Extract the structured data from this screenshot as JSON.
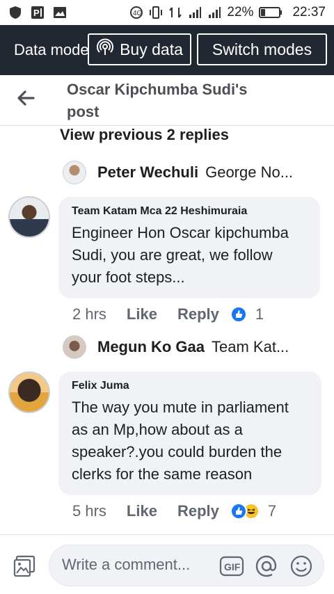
{
  "status_bar": {
    "battery": "22%",
    "time": "22:37",
    "icons": [
      "shield-icon",
      "parking-icon",
      "gallery-icon",
      "nfc-icon",
      "vibrate-icon",
      "signal-icon",
      "hd-signal-icon",
      "battery-icon"
    ]
  },
  "data_banner": {
    "label": "Data mode",
    "buy_label": "Buy data",
    "switch_label": "Switch modes"
  },
  "header": {
    "title": "Oscar Kipchumba Sudi's post"
  },
  "view_previous": "View previous 2 replies",
  "reply_previews": [
    {
      "name": "Peter Wechuli",
      "text": "George No..."
    },
    {
      "name": "Megun Ko Gaa",
      "text": "Team  Kat..."
    }
  ],
  "comments": [
    {
      "author": "Team  Katam Mca 22 Heshimuraia",
      "body": "Engineer Hon Oscar kipchumba Sudi, you are great, we follow your foot steps...",
      "time": "2 hrs",
      "like": "Like",
      "reply": "Reply",
      "reaction_count": "1"
    },
    {
      "author": "Felix Juma",
      "body": "The way you mute in parliament as an Mp,how about as a speaker?.you could burden the clerks for the same reason",
      "time": "5 hrs",
      "like": "Like",
      "reply": "Reply",
      "reaction_count": "7"
    }
  ],
  "composer": {
    "placeholder": "Write a comment...",
    "gif_label": "GIF"
  },
  "colors": {
    "banner_bg": "#222831",
    "bubble_bg": "#f0f2f5",
    "like_blue": "#1877f2",
    "haha_yellow": "#f7c22b"
  }
}
